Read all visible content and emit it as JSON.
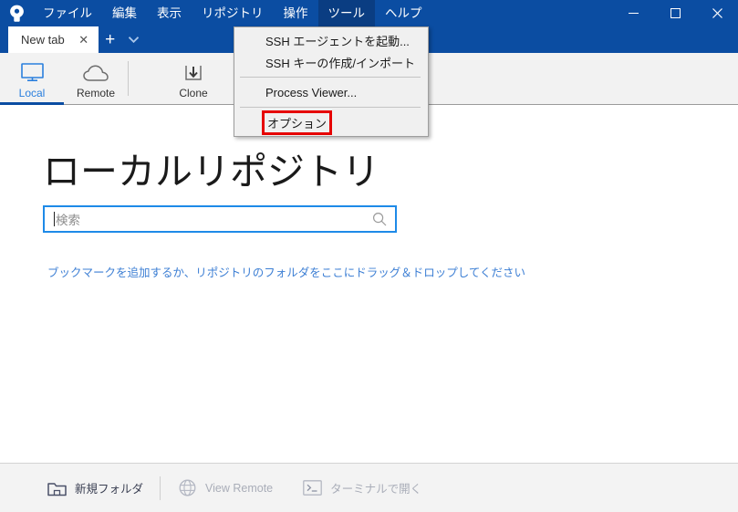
{
  "window": {
    "logo_icon": "sourcetree-logo-icon",
    "controls": {
      "minimize": "—",
      "maximize": "□",
      "close": "✕"
    }
  },
  "menubar": {
    "items": [
      {
        "label": "ファイル",
        "active": false
      },
      {
        "label": "編集",
        "active": false
      },
      {
        "label": "表示",
        "active": false
      },
      {
        "label": "リポジトリ",
        "active": false
      },
      {
        "label": "操作",
        "active": false
      },
      {
        "label": "ツール",
        "active": true
      },
      {
        "label": "ヘルプ",
        "active": false
      }
    ]
  },
  "dropdown": {
    "owner": "ツール",
    "items": [
      {
        "label": "SSH エージェントを起動...",
        "type": "item",
        "annotated": false
      },
      {
        "label": "SSH キーの作成/インポート",
        "type": "item",
        "annotated": false
      },
      {
        "label": "",
        "type": "separator",
        "annotated": false
      },
      {
        "label": "Process Viewer...",
        "type": "item",
        "annotated": false
      },
      {
        "label": "",
        "type": "separator",
        "annotated": false
      },
      {
        "label": "オプション",
        "type": "item",
        "annotated": true
      }
    ],
    "annotation_color": "#e60000"
  },
  "tabstrip": {
    "tab_label": "New tab",
    "close_glyph": "✕",
    "add_glyph": "+",
    "caret_icon": "chevron-down-icon"
  },
  "toolbar": {
    "buttons": [
      {
        "label": "Local",
        "icon": "monitor-icon",
        "selected": true
      },
      {
        "label": "Remote",
        "icon": "cloud-icon",
        "selected": false
      },
      {
        "label": "Clone",
        "icon": "clone-download-icon",
        "selected": false
      }
    ],
    "accent": "#0b4da2",
    "selected_text_color": "#2a7fdd"
  },
  "main": {
    "title": "ローカルリポジトリ",
    "search": {
      "value": "",
      "placeholder": "検索",
      "icon": "search-icon",
      "focused": true,
      "border_color": "#1e8ae8"
    },
    "drop_hint": "ブックマークを追加するか、リポジトリのフォルダをここにドラッグ＆ドロップしてください",
    "drop_hint_color": "#3d7fd4"
  },
  "bottombar": {
    "buttons": [
      {
        "label": "新規フォルダ",
        "icon": "new-folder-icon",
        "disabled": false
      },
      {
        "label": "View Remote",
        "icon": "globe-icon",
        "disabled": true
      },
      {
        "label": "ターミナルで開く",
        "icon": "terminal-icon",
        "disabled": true
      }
    ]
  }
}
